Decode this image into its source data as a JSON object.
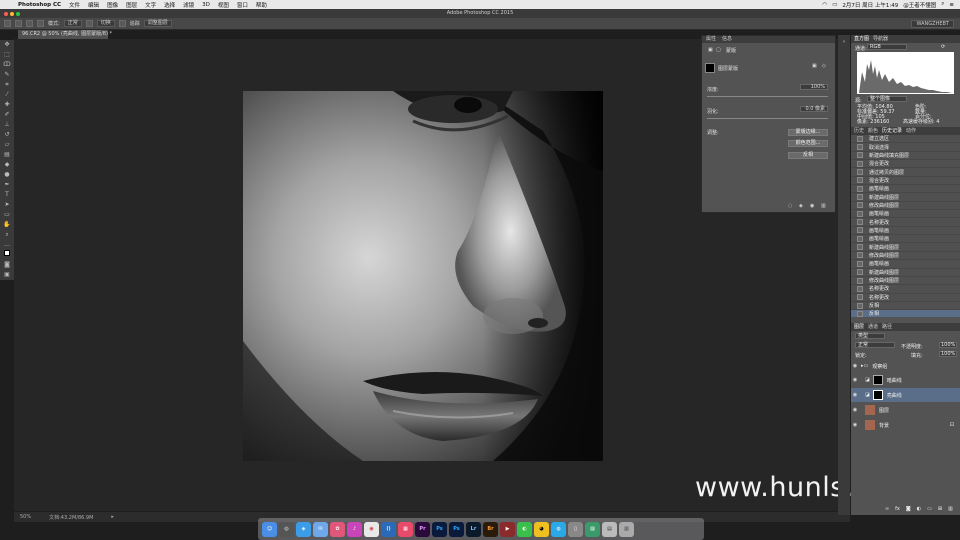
{
  "menubar": {
    "app": "Photoshop CC",
    "items": [
      "文件",
      "编辑",
      "图像",
      "图层",
      "文字",
      "选择",
      "滤镜",
      "3D",
      "视图",
      "窗口",
      "帮助"
    ],
    "clock": "2月7日 周日 上午1:49",
    "user": "@王者不懂图"
  },
  "window": {
    "title": "Adobe Photoshop CC 2015"
  },
  "options": {
    "mode_label": "模式:",
    "mode_value": "正常",
    "opt1": "切换",
    "opt2": "追踪",
    "opt3": "调整图层",
    "workspace": "WANGZHEBT"
  },
  "document": {
    "tab": "96.CR2 @ 50% (亮曲线, 图层蒙版/8) *",
    "zoom": "50%",
    "docsize": "文档:43.2M/86.9M"
  },
  "watermark": "www.hunls.com",
  "properties": {
    "tabs": [
      "属性",
      "信息"
    ],
    "title": "蒙版",
    "mask_label": "图层蒙版",
    "density_label": "浓度:",
    "density_value": "100%",
    "feather_label": "羽化:",
    "feather_value": "0.0 像素",
    "refine_label": "调整:",
    "btn_edge": "蒙版边缘...",
    "btn_color": "颜色范围...",
    "btn_invert": "反相"
  },
  "histogram": {
    "tabs": [
      "直方图",
      "导航器"
    ],
    "channel_label": "通道:",
    "channel_value": "RGB",
    "source_label": "源:",
    "source_value": "整个图像",
    "stats_left": [
      "平均值: 104.80",
      "标准偏差: 59.37",
      "中间值: 105",
      "像素: 236160"
    ],
    "stats_right": [
      "色阶:",
      "数量:",
      "百分位:",
      "高速缓存级别: 4"
    ]
  },
  "history": {
    "tabs": [
      "历史",
      "颜色",
      "历史记录",
      "动作"
    ],
    "items": [
      "建立选区",
      "取消选择",
      "新建曲线填充图层",
      "混合更改",
      "通过拷贝的图层",
      "混合更改",
      "画笔绘画",
      "新建曲线图层",
      "修改曲线图层",
      "画笔绘画",
      "名称更改",
      "画笔绘画",
      "画笔绘画",
      "新建曲线图层",
      "修改曲线图层",
      "画笔绘画",
      "新建曲线图层",
      "修改曲线图层",
      "名称更改",
      "名称更改",
      "反相",
      "反相"
    ]
  },
  "layers": {
    "tabs": [
      "图层",
      "通道",
      "路径"
    ],
    "kind_value": "类型",
    "blend_value": "正常",
    "opacity_label": "不透明度:",
    "opacity_value": "100%",
    "lock_label": "锁定:",
    "fill_label": "填充:",
    "fill_value": "100%",
    "rows": [
      {
        "name": "观察组",
        "kind": "group"
      },
      {
        "name": "暗曲线",
        "kind": "adjust"
      },
      {
        "name": "亮曲线",
        "kind": "adjust"
      },
      {
        "name": "图层",
        "kind": "photo"
      },
      {
        "name": "背景",
        "kind": "photo"
      }
    ]
  },
  "dock": {
    "apps": [
      "Finder",
      "Launchpad",
      "Safari",
      "Mail",
      "Photos",
      "Music",
      "Chrome",
      "VSCode",
      "Store",
      "Premiere",
      "Photoshop",
      "Photoshop",
      "Lightroom",
      "Bridge",
      "Media",
      "WeChat",
      "QQ",
      "Preview",
      "Trash"
    ]
  },
  "colors": {
    "accent": "#5a6e8a",
    "panel": "#535353",
    "workspace": "#262626"
  }
}
